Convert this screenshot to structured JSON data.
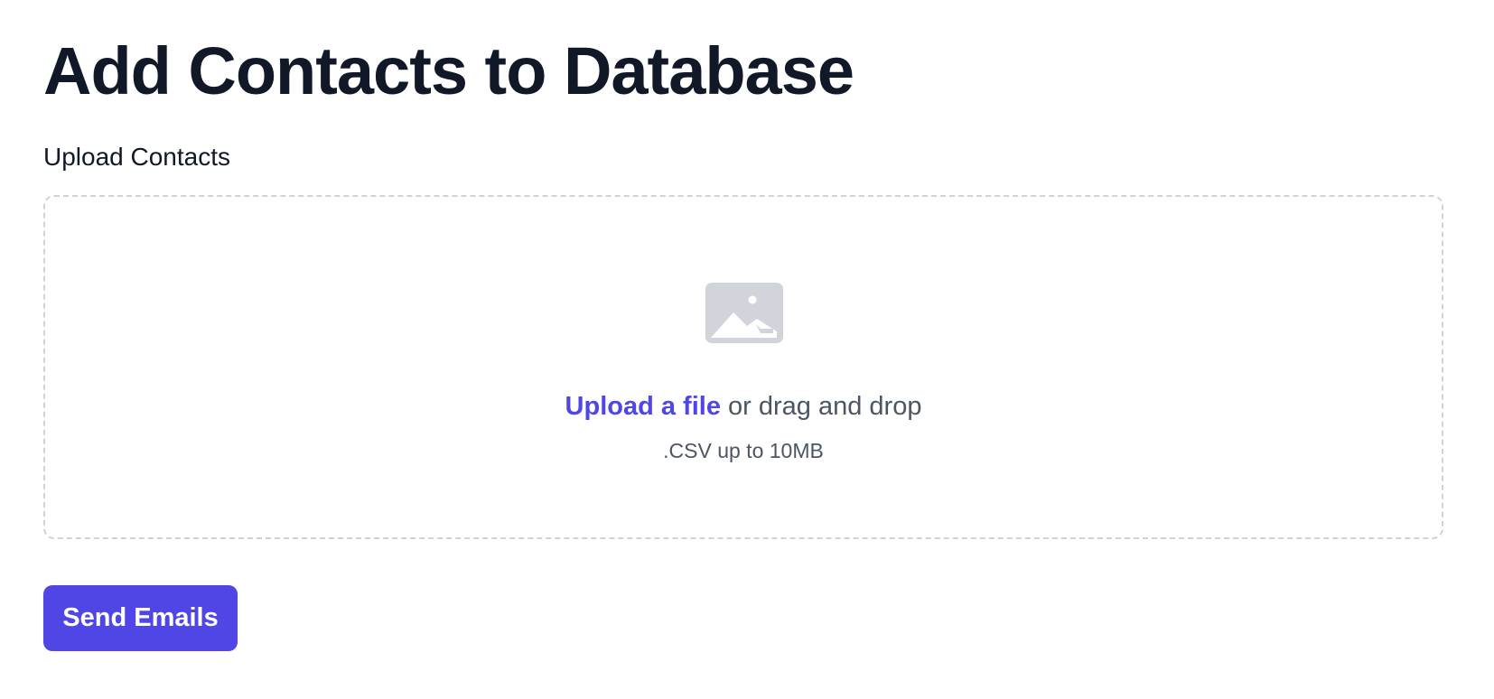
{
  "page": {
    "title": "Add Contacts to Database"
  },
  "upload": {
    "label": "Upload Contacts",
    "icon": "image-icon",
    "link_text": "Upload a file",
    "drag_text": " or drag and drop",
    "hint": ".CSV up to 10MB"
  },
  "actions": {
    "send_label": "Send Emails"
  },
  "colors": {
    "accent": "#4f46e5",
    "text_primary": "#111827",
    "text_secondary": "#4b5563",
    "icon_gray": "#d1d5db",
    "border_dashed": "#cfd3d9"
  }
}
